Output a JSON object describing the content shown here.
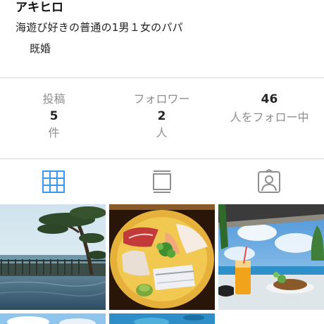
{
  "profile": {
    "name": "アキヒロ",
    "bio_line1": "海遊び好きの普通の1男１女のパパ",
    "bio_line2": "既婚"
  },
  "stats": {
    "posts": {
      "label": "投稿",
      "value": "5",
      "unit": "件"
    },
    "followers": {
      "label": "フォロワー",
      "value": "2",
      "unit": "人"
    },
    "following": {
      "value": "46",
      "label": "人をフォロー中"
    }
  },
  "tabs": [
    {
      "icon": "grid-icon",
      "active": true
    },
    {
      "icon": "feed-icon",
      "active": false
    },
    {
      "icon": "tagged-person-icon",
      "active": false
    }
  ],
  "colors": {
    "active_tab": "#3897f0",
    "inactive_tab": "#8e8e8e",
    "divider": "#dbdbdb"
  },
  "photos": [
    {
      "subject": "infinity-pool-with-pine-tree"
    },
    {
      "subject": "sashimi-plate"
    },
    {
      "subject": "beach-cafe-drink-and-meal"
    },
    {
      "subject": "beach-photo-partial"
    },
    {
      "subject": "underwater-photo-partial"
    }
  ]
}
